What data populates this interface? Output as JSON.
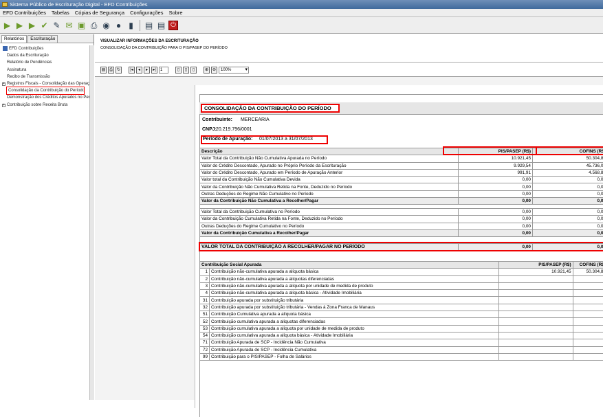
{
  "window": {
    "title": "Sistema Público de Escrituração Digital - EFD Contribuições"
  },
  "menu": [
    "EFD Contribuições",
    "Tabelas",
    "Cópias de Segurança",
    "Configurações",
    "Sobre"
  ],
  "left_tabs": [
    "Relatórios",
    "Escrituração"
  ],
  "tree": [
    {
      "label": "EFD Contribuições",
      "level": 0
    },
    {
      "label": "Dados da Escrituração",
      "level": 1
    },
    {
      "label": "Relatório de Pendências",
      "level": 1
    },
    {
      "label": "Assinatura",
      "level": 1
    },
    {
      "label": "Recibo de Transmissão",
      "level": 1
    },
    {
      "label": "Registros Fiscais - Consolidação das Operaç",
      "level": 1,
      "expand": true
    },
    {
      "label": "Consolidação da Contribuição do Período",
      "level": 1,
      "selected": true
    },
    {
      "label": "Demonstração dos Créditos Apurados no Per",
      "level": 1
    },
    {
      "label": "Contribuição sobre Receita Bruta",
      "level": 1,
      "expand": true
    }
  ],
  "view": {
    "heading": "VISUALIZAR INFORMAÇÕES DA ESCRITURAÇÃO",
    "subheading": "CONSOLIDAÇÃO DA CONTRIBUIÇÃO PARA O PIS/PASEP DO PERÍODO"
  },
  "reportbar": {
    "page": "1",
    "zoom": "100%"
  },
  "report": {
    "title": "CONSOLIDAÇÃO DA CONTRIBUIÇÃO DO PERÍODO",
    "contribuinte_label": "Contribuinte:",
    "contribuinte": "MERCEARIA",
    "cnpj_label": "CNPJ:",
    "cnpj": "20.219.796/0001",
    "periodo_label": "Período de Apuração:",
    "periodo": "01/07/2013 a 31/07/2013",
    "table1": {
      "headers": [
        "Descrição",
        "PIS/PASEP (R$)",
        "COFINS (R$)"
      ],
      "rows": [
        [
          "Valor Total da Contribuição Não Cumulativa Apurada no Período",
          "10.921,45",
          "50.304,89"
        ],
        [
          "Valor do Crédito Descontado, Apurado no Próprio Período da Escrituração",
          "9.929,54",
          "45.736,03"
        ],
        [
          "Valor do Crédito Descontado, Apurado em Período de Apuração Anterior",
          "991,91",
          "4.568,86"
        ],
        [
          "Valor total da Contribuição Não Cumulativa Devida",
          "0,00",
          "0,00"
        ],
        [
          "Valor da Contribuição Não Cumulativa Retida na Fonte, Deduzido no Período",
          "0,00",
          "0,00"
        ],
        [
          "Outras Deduções do Regime Não Cumulativo no Período",
          "0,00",
          "0,00"
        ]
      ],
      "total": [
        "Valor da Contribuição Não Cumulativa a Recolher/Pagar",
        "0,00",
        "0,00"
      ]
    },
    "table2": {
      "rows": [
        [
          "Valor Total da Contribuição Cumulativa no Período",
          "0,00",
          "0,00"
        ],
        [
          "Valor da Contribuição Cumulativa Retida na Fonte, Deduzido no Período",
          "0,00",
          "0,00"
        ],
        [
          "Outras Deduções do Regime Cumulativo no Período",
          "0,00",
          "0,00"
        ]
      ],
      "total": [
        "Valor da Contribuição Cumulativa a Recolher/Pagar",
        "0,00",
        "0,00"
      ]
    },
    "grand_total": [
      "VALOR TOTAL DA CONTRIBUIÇÃO A RECOLHER/PAGAR NO PERÍODO",
      "0,00",
      "0,00"
    ],
    "table3": {
      "headers": [
        "Contribuição Social Apurada",
        "PIS/PASEP (R$)",
        "COFINS (R$)"
      ],
      "rows": [
        [
          "1",
          "Contribuição não-cumulativa apurada a alíquota básica",
          "10.921,45",
          "50.304,89"
        ],
        [
          "2",
          "Contribuição não-cumulativa apurada a alíquotas diferenciadas",
          "",
          ""
        ],
        [
          "3",
          "Contribuição não-cumulativa apurada a alíquota por unidade de medida de produto",
          "",
          ""
        ],
        [
          "4",
          "Contribuição não-cumulativa apurada a alíquota básica - Atividade Imobiliária",
          "",
          ""
        ],
        [
          "31",
          "Contribuição apurada por substituição tributária",
          "",
          ""
        ],
        [
          "32",
          "Contribuição apurada por substituição tributária - Vendas à Zona Franca de Manaus",
          "",
          ""
        ],
        [
          "51",
          "Contribuição Cumulativa apurada a alíquota básica",
          "",
          ""
        ],
        [
          "52",
          "Contribuição cumulativa apurada a alíquotas diferenciadas",
          "",
          ""
        ],
        [
          "53",
          "Contribuição cumulativa apurada a alíquota por unidade de medida de produto",
          "",
          ""
        ],
        [
          "54",
          "Contribuição cumulativa apurada a alíquota básica - Atividade Imobiliária",
          "",
          ""
        ],
        [
          "71",
          "Contribuição Apurada de SCP - Incidência Não Cumulativa",
          "",
          ""
        ],
        [
          "72",
          "Contribuição Apurada de SCP - Incidência Cumulativa",
          "",
          ""
        ],
        [
          "99",
          "Contribuição para o PIS/PASEP - Folha de Salários",
          "",
          ""
        ]
      ]
    }
  },
  "colors": {
    "highlight": "#e00000",
    "titlebar": "#3f6a9c"
  }
}
